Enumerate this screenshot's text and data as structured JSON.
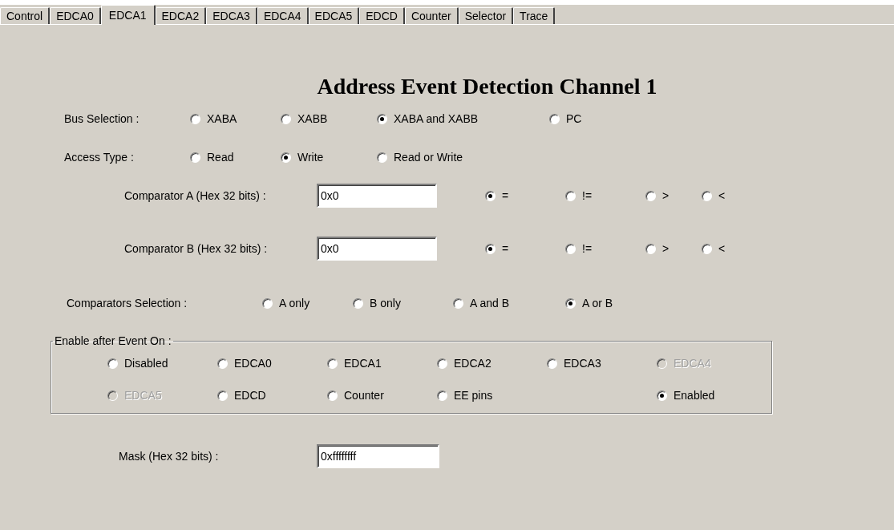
{
  "tabs": [
    {
      "label": "Control",
      "selected": false
    },
    {
      "label": "EDCA0",
      "selected": false
    },
    {
      "label": "EDCA1",
      "selected": true
    },
    {
      "label": "EDCA2",
      "selected": false
    },
    {
      "label": "EDCA3",
      "selected": false
    },
    {
      "label": "EDCA4",
      "selected": false
    },
    {
      "label": "EDCA5",
      "selected": false
    },
    {
      "label": "EDCD",
      "selected": false
    },
    {
      "label": "Counter",
      "selected": false
    },
    {
      "label": "Selector",
      "selected": false
    },
    {
      "label": "Trace",
      "selected": false
    }
  ],
  "title": "Address Event Detection Channel 1",
  "bus_selection": {
    "label": "Bus Selection :",
    "options": [
      {
        "label": "XABA",
        "selected": false
      },
      {
        "label": "XABB",
        "selected": false
      },
      {
        "label": "XABA and XABB",
        "selected": true
      },
      {
        "label": "PC",
        "selected": false
      }
    ]
  },
  "access_type": {
    "label": "Access Type :",
    "options": [
      {
        "label": "Read",
        "selected": false
      },
      {
        "label": "Write",
        "selected": true
      },
      {
        "label": "Read or Write",
        "selected": false
      }
    ]
  },
  "comparators": [
    {
      "label": "Comparator A (Hex 32 bits) :",
      "value": "0x0",
      "operators": [
        {
          "label": "=",
          "selected": true
        },
        {
          "label": "!=",
          "selected": false
        },
        {
          "label": ">",
          "selected": false
        },
        {
          "label": "<",
          "selected": false
        }
      ]
    },
    {
      "label": "Comparator B (Hex 32 bits) :",
      "value": "0x0",
      "operators": [
        {
          "label": "=",
          "selected": true
        },
        {
          "label": "!=",
          "selected": false
        },
        {
          "label": ">",
          "selected": false
        },
        {
          "label": "<",
          "selected": false
        }
      ]
    }
  ],
  "comparators_selection": {
    "label": "Comparators Selection :",
    "options": [
      {
        "label": "A only",
        "selected": false
      },
      {
        "label": "B only",
        "selected": false
      },
      {
        "label": "A and B",
        "selected": false
      },
      {
        "label": "A or B",
        "selected": true
      }
    ]
  },
  "enable_after_event": {
    "label": "Enable after Event On :",
    "rows": [
      [
        {
          "label": "Disabled",
          "selected": false,
          "disabled": false
        },
        {
          "label": "EDCA0",
          "selected": false,
          "disabled": false
        },
        {
          "label": "EDCA1",
          "selected": false,
          "disabled": false
        },
        {
          "label": "EDCA2",
          "selected": false,
          "disabled": false
        },
        {
          "label": "EDCA3",
          "selected": false,
          "disabled": false
        },
        {
          "label": "EDCA4",
          "selected": false,
          "disabled": true
        }
      ],
      [
        {
          "label": "EDCA5",
          "selected": false,
          "disabled": true
        },
        {
          "label": "EDCD",
          "selected": false,
          "disabled": false
        },
        {
          "label": "Counter",
          "selected": false,
          "disabled": false
        },
        {
          "label": "EE pins",
          "selected": false,
          "disabled": false
        },
        "",
        {
          "label": "Enabled",
          "selected": true,
          "disabled": false
        }
      ]
    ]
  },
  "mask": {
    "label": "Mask (Hex 32 bits) :",
    "value": "0xffffffff"
  }
}
